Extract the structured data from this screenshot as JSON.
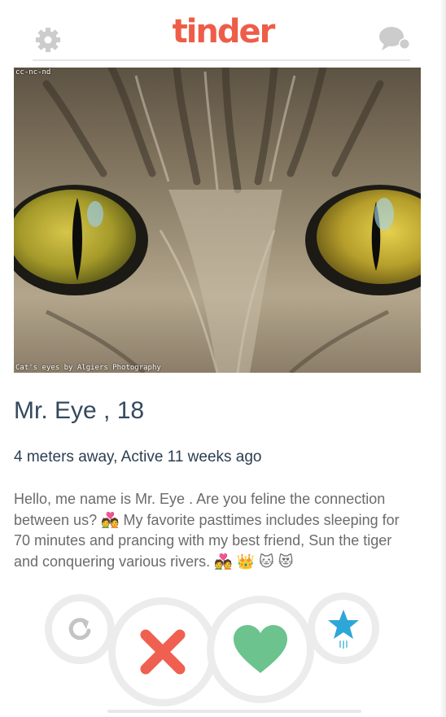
{
  "header": {
    "logo_text": "tinder",
    "brand_color": "#ee5d48",
    "settings_icon": "gear-icon",
    "messages_icon": "chat-bubbles-icon"
  },
  "photo": {
    "license_text": "cc-nc-nd",
    "credit_text": "Cat's eyes by Algiers Photography"
  },
  "profile": {
    "name": "Mr. Eye , 18",
    "distance": "4 meters away, Active 11 weeks ago",
    "bio_text": "Hello, me name is Mr. Eye . Are you feline the connection between us? 💑 My favorite pasttimes includes sleeping for 70 minutes and prancing with my best friend, Sun the tiger and conquering various rivers. 💑 👑 🐱 😻"
  },
  "actions": {
    "undo_icon": "undo-icon",
    "nope_icon": "x-icon",
    "like_icon": "heart-icon",
    "superlike_icon": "star-icon",
    "nope_color": "#ef6050",
    "like_color": "#6cc38e",
    "superlike_color": "#2ea7d8"
  }
}
